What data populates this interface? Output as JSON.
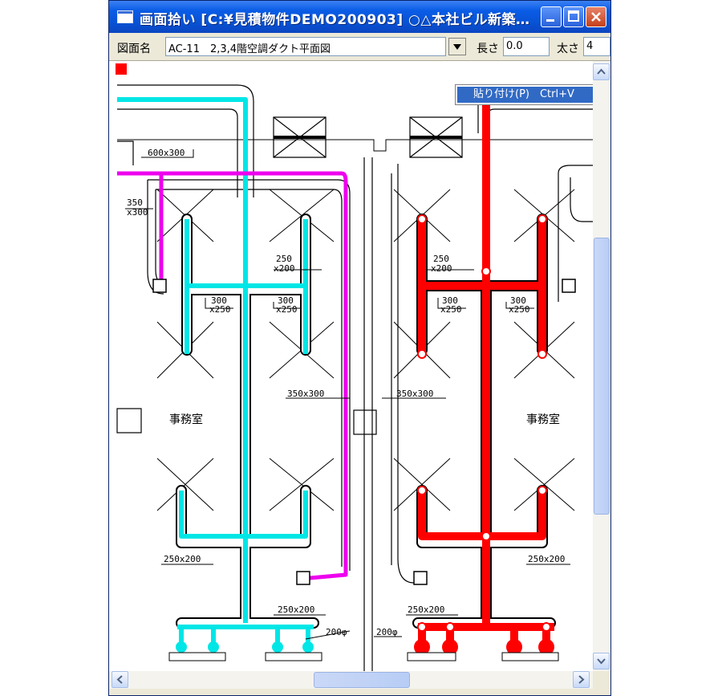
{
  "window": {
    "title": "画面拾い [C:¥見積物件DEMO200903] ○△本社ビル新築…"
  },
  "toolbar": {
    "drawing_name_label": "図面名",
    "drawing_name_value": "AC-11　2,3,4階空調ダクト平面図",
    "length_label": "長さ",
    "length_value": "0.0",
    "thickness_label": "太さ",
    "thickness_value": "4"
  },
  "context_menu": {
    "paste_label": "貼り付け(P)　Ctrl+V"
  },
  "drawing": {
    "rooms": [
      "事務室",
      "事務室"
    ],
    "dim_labels": {
      "d600x300": "600x300",
      "d350": "350",
      "x300": "x300",
      "d250a": "250",
      "x200a": "x200",
      "d300a": "300",
      "x250a": "x250",
      "d300b": "300",
      "x250b": "x250",
      "d350x300": "350x300",
      "d250x200a": "250x200",
      "d250x200b": "250x200",
      "d200phi": "200φ",
      "d250r": "250",
      "x200r": "x200",
      "d300r1": "300",
      "x250r1": "x250",
      "d300r2": "300",
      "x250r2": "x250",
      "d350x300r": "350x300",
      "d250x200r1": "250x200",
      "d250x200r2": "250x200",
      "d200phir": "200φ"
    },
    "colors": {
      "cyan_trace": "#00e6e6",
      "magenta_trace": "#ee00ee",
      "red_trace": "#ff0000",
      "marker": "#ff0000"
    }
  },
  "icons": {
    "app": "window-icon",
    "minimize": "minimize-icon",
    "maximize": "maximize-icon",
    "close": "close-icon",
    "dropdown": "chevron-down-icon"
  }
}
